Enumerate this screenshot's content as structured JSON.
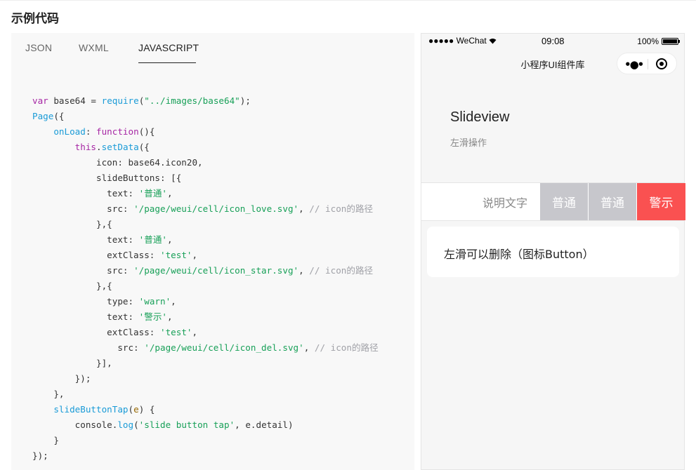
{
  "section": {
    "title": "示例代码"
  },
  "tabs": [
    {
      "label": "JSON",
      "active": false
    },
    {
      "label": "WXML",
      "active": false
    },
    {
      "label": "JAVASCRIPT",
      "active": true
    }
  ],
  "code_lines": [
    [
      [
        "kw",
        "var"
      ],
      [
        "op",
        " base64 "
      ],
      [
        "op",
        "="
      ],
      [
        "op",
        " "
      ],
      [
        "fn",
        "require"
      ],
      [
        "op",
        "("
      ],
      [
        "str",
        "\"../images/base64\""
      ],
      [
        "op",
        ");"
      ]
    ],
    [
      [
        "fn",
        "Page"
      ],
      [
        "op",
        "({"
      ]
    ],
    [
      [
        "op",
        "    "
      ],
      [
        "pr",
        "onLoad"
      ],
      [
        "op",
        ": "
      ],
      [
        "kw",
        "function"
      ],
      [
        "op",
        "(){"
      ]
    ],
    [
      [
        "op",
        "        "
      ],
      [
        "kw",
        "this"
      ],
      [
        "op",
        "."
      ],
      [
        "fn",
        "setData"
      ],
      [
        "op",
        "({"
      ]
    ],
    [
      [
        "op",
        "            icon: base64.icon20,"
      ]
    ],
    [
      [
        "op",
        "            slideButtons: [{"
      ]
    ],
    [
      [
        "op",
        "              text: "
      ],
      [
        "str",
        "'普通'"
      ],
      [
        "op",
        ","
      ]
    ],
    [
      [
        "op",
        "              src: "
      ],
      [
        "str",
        "'/page/weui/cell/icon_love.svg'"
      ],
      [
        "op",
        ", "
      ],
      [
        "cm",
        "// icon的路径"
      ]
    ],
    [
      [
        "op",
        "            },{"
      ]
    ],
    [
      [
        "op",
        "              text: "
      ],
      [
        "str",
        "'普通'"
      ],
      [
        "op",
        ","
      ]
    ],
    [
      [
        "op",
        "              extClass: "
      ],
      [
        "str",
        "'test'"
      ],
      [
        "op",
        ","
      ]
    ],
    [
      [
        "op",
        "              src: "
      ],
      [
        "str",
        "'/page/weui/cell/icon_star.svg'"
      ],
      [
        "op",
        ", "
      ],
      [
        "cm",
        "// icon的路径"
      ]
    ],
    [
      [
        "op",
        "            },{"
      ]
    ],
    [
      [
        "op",
        "              type: "
      ],
      [
        "str",
        "'warn'"
      ],
      [
        "op",
        ","
      ]
    ],
    [
      [
        "op",
        "              text: "
      ],
      [
        "str",
        "'警示'"
      ],
      [
        "op",
        ","
      ]
    ],
    [
      [
        "op",
        "              extClass: "
      ],
      [
        "str",
        "'test'"
      ],
      [
        "op",
        ","
      ]
    ],
    [
      [
        "op",
        "                src: "
      ],
      [
        "str",
        "'/page/weui/cell/icon_del.svg'"
      ],
      [
        "op",
        ", "
      ],
      [
        "cm",
        "// icon的路径"
      ]
    ],
    [
      [
        "op",
        "            }],"
      ]
    ],
    [
      [
        "op",
        "        });"
      ]
    ],
    [
      [
        "op",
        "    },"
      ]
    ],
    [
      [
        "op",
        "    "
      ],
      [
        "pr",
        "slideButtonTap"
      ],
      [
        "op",
        "("
      ],
      [
        "pm",
        "e"
      ],
      [
        "op",
        ") {"
      ]
    ],
    [
      [
        "op",
        "        console."
      ],
      [
        "fn",
        "log"
      ],
      [
        "op",
        "("
      ],
      [
        "str",
        "'slide button tap'"
      ],
      [
        "op",
        ", e.detail)"
      ]
    ],
    [
      [
        "op",
        "    }"
      ]
    ],
    [
      [
        "op",
        "});"
      ]
    ]
  ],
  "phone": {
    "status": {
      "carrier": "●●●●● WeChat",
      "time": "09:08",
      "battery": "100%",
      "battery_level": 1.0
    },
    "nav_title": "小程序UI组件库",
    "page_title": "Slideview",
    "page_desc": "左滑操作",
    "slide_text": "说明文字",
    "slide_buttons": [
      "普通",
      "普通",
      "警示"
    ],
    "card_text": "左滑可以删除（图标Button）"
  },
  "colors": {
    "warn": "#fa5151",
    "default_button": "#c7c7cc"
  }
}
